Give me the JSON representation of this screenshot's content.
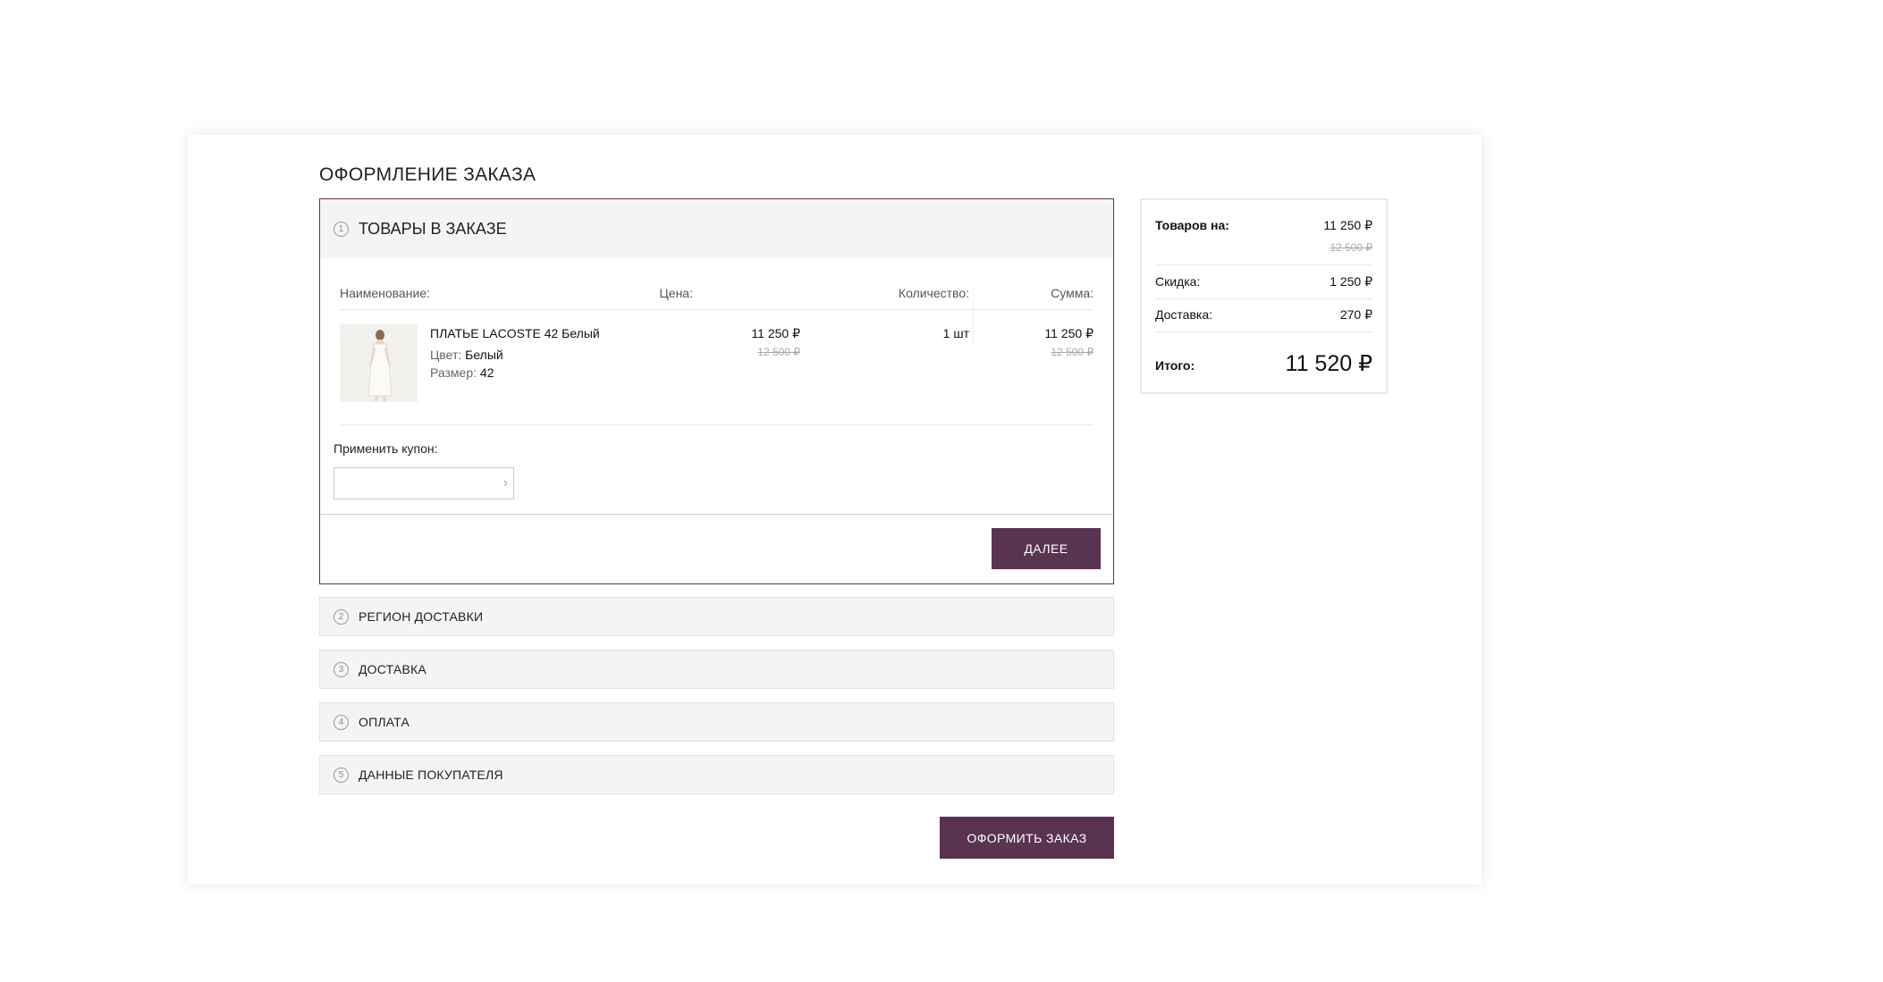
{
  "page_title": "ОФОРМЛЕНИЕ ЗАКАЗА",
  "colors": {
    "accent": "#5a3350",
    "panel_bg": "#f4f4f4"
  },
  "step1": {
    "number": "1",
    "label": "ТОВАРЫ В ЗАКАЗЕ",
    "headers": {
      "name": "Наименование:",
      "price": "Цена:",
      "quantity": "Количество:",
      "sum": "Сумма:"
    },
    "item": {
      "name": "ПЛАТЬЕ LACOSTE 42 Белый",
      "color_label": "Цвет:",
      "color_value": "Белый",
      "size_label": "Размер:",
      "size_value": "42",
      "price": "11 250 ₽",
      "price_old": "12 500 ₽",
      "quantity": "1 шт",
      "sum": "11 250 ₽",
      "sum_old": "12 500 ₽",
      "image_icon": "dress-product-photo"
    },
    "coupon_label": "Применить купон:",
    "coupon_value": "",
    "next_button": "ДАЛЕЕ"
  },
  "steps": [
    {
      "number": "2",
      "label": "РЕГИОН ДОСТАВКИ"
    },
    {
      "number": "3",
      "label": "ДОСТАВКА"
    },
    {
      "number": "4",
      "label": "ОПЛАТА"
    },
    {
      "number": "5",
      "label": "ДАННЫЕ ПОКУПАТЕЛЯ"
    }
  ],
  "submit_button": "ОФОРМИТЬ ЗАКАЗ",
  "summary": {
    "goods_label": "Товаров на:",
    "goods_value": "11 250 ₽",
    "goods_old": "12 500 ₽",
    "discount_label": "Скидка:",
    "discount_value": "1 250 ₽",
    "delivery_label": "Доставка:",
    "delivery_value": "270 ₽",
    "total_label": "Итого:",
    "total_value": "11 520 ₽"
  }
}
